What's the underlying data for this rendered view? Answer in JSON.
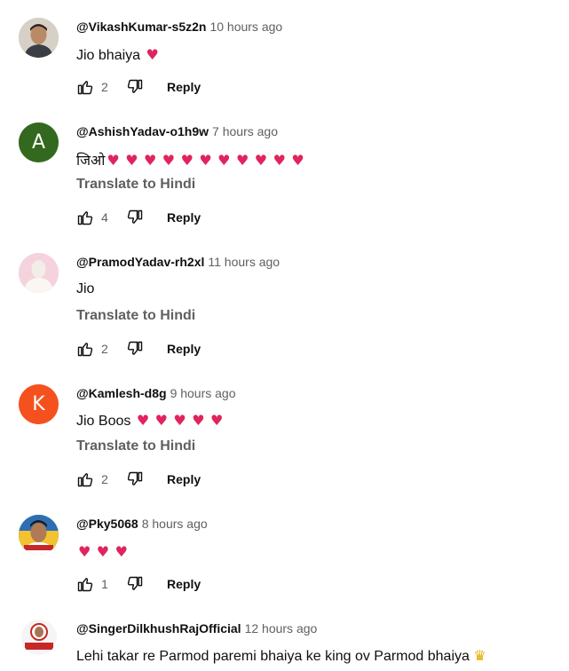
{
  "comments": [
    {
      "author": "@VikashKumar-s5z2n",
      "time": "10 hours ago",
      "text": "Jio bhaiya",
      "hearts": 1,
      "translate": "",
      "likes": "2",
      "reply": "Reply",
      "avatar_letter": "",
      "avatar_color": "#c9c2b8"
    },
    {
      "author": "@AshishYadav-o1h9w",
      "time": "7 hours ago",
      "text": "जिओ",
      "hearts": 11,
      "translate": "Translate to Hindi",
      "likes": "4",
      "reply": "Reply",
      "avatar_letter": "A",
      "avatar_color": "#33691e"
    },
    {
      "author": "@PramodYadav-rh2xl",
      "time": "11 hours ago",
      "text": "Jio",
      "hearts": 0,
      "translate": "Translate to Hindi",
      "likes": "2",
      "reply": "Reply",
      "avatar_letter": "",
      "avatar_color": "#f2c9d6"
    },
    {
      "author": "@Kamlesh-d8g",
      "time": "9 hours ago",
      "text": "Jio Boos",
      "hearts": 5,
      "translate": "Translate to Hindi",
      "likes": "2",
      "reply": "Reply",
      "avatar_letter": "K",
      "avatar_color": "#f4511e"
    },
    {
      "author": "@Pky5068",
      "time": "8 hours ago",
      "text": "",
      "hearts": 3,
      "translate": "",
      "likes": "1",
      "reply": "Reply",
      "avatar_letter": "",
      "avatar_color": "#2d6fb5"
    },
    {
      "author": "@SingerDilkhushRajOfficial",
      "time": "12 hours ago",
      "text": "Lehi takar re Parmod paremi bhaiya ke king ov Parmod bhaiya",
      "hearts": 0,
      "translate": "",
      "likes": "",
      "reply": "",
      "avatar_letter": "",
      "avatar_color": "#f5f5f5"
    }
  ],
  "colors": {
    "heart": "#e0245e",
    "secondary_text": "#606060",
    "crown": "#e6a800"
  },
  "icons": {
    "like": "thumbs-up-icon",
    "dislike": "thumbs-down-icon",
    "crown": "crown-icon",
    "heart": "heart-icon"
  }
}
